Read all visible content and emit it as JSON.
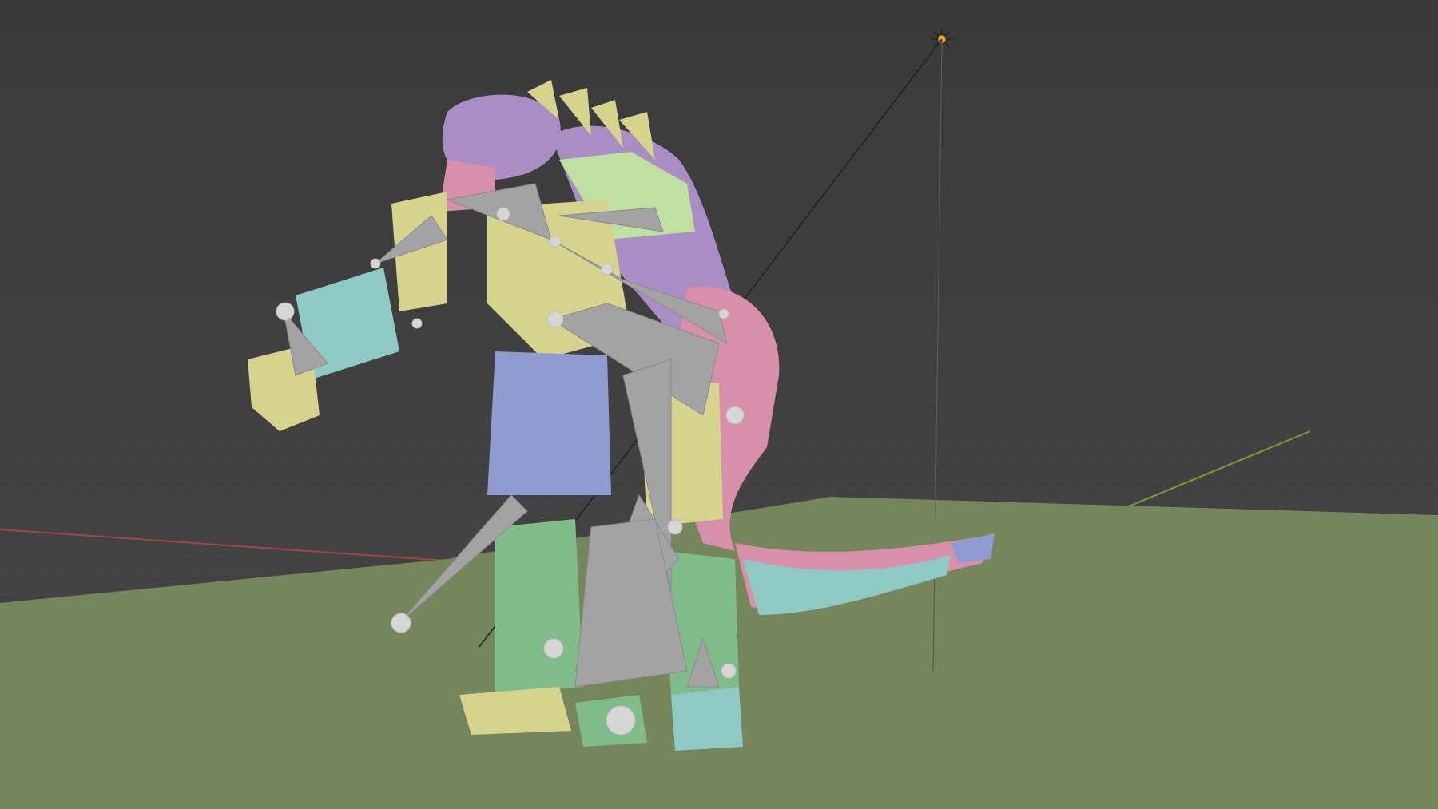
{
  "viewport": {
    "name": "3D viewport",
    "background_color": "#3d3d3d",
    "floor_plane_color": "#76865c",
    "grid_line_color": "#4a4a4a",
    "x_axis_color": "#a04646",
    "y_axis_color": "#7f9a3a"
  },
  "scene": {
    "objects": [
      {
        "name": "creature-mesh",
        "colors": [
          "#a98ec4",
          "#d6d38f",
          "#8fc9c4",
          "#8f9bd1",
          "#7fbc8a",
          "#d88fa9",
          "#bfe0a0"
        ]
      },
      {
        "name": "armature-bones",
        "color": "#a3a3a3",
        "joint_color": "#d6d6d6"
      },
      {
        "name": "light",
        "color": "#f0a030"
      }
    ]
  }
}
